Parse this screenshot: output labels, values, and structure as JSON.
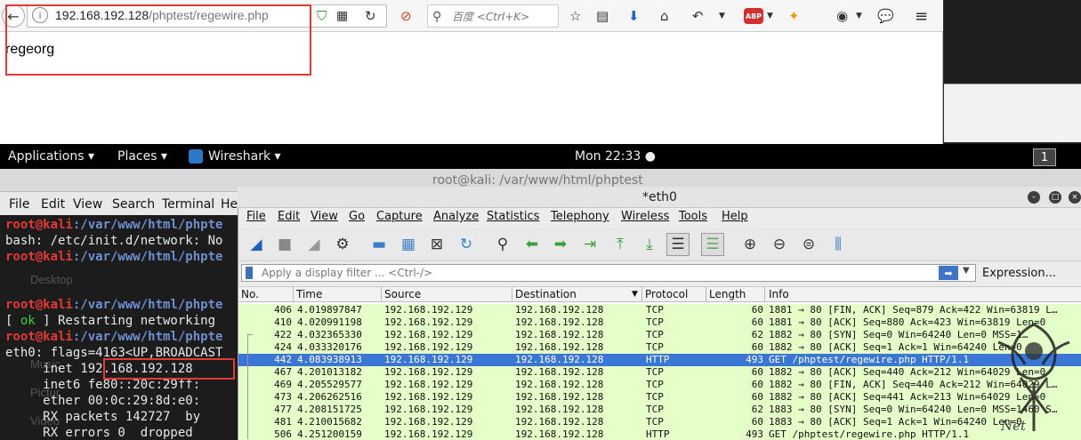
{
  "browser": {
    "url_host": "192.168.192.128",
    "url_path": "/phptest/regewire.php",
    "search_placeholder": "百度 <Ctrl+K>",
    "page_text": "regeorg",
    "adblock_badge": "ABP"
  },
  "topbar": {
    "applications": "Applications ▾",
    "places": "Places ▾",
    "wireshark": "Wireshark ▾",
    "clock": "Mon 22:33 ●",
    "workspace": "1"
  },
  "terminal": {
    "title": "root@kali: /var/www/html/phptest",
    "menu": [
      "File",
      "Edit",
      "View",
      "Search",
      "Terminal",
      "He"
    ],
    "prompt_user": "root@kali",
    "prompt_path": ":/var/www/html/phpte",
    "line_bash": "bash: /etc/init.d/network: No",
    "line_restart_open": "[ ",
    "line_restart_ok": "ok",
    "line_restart_rest": " ] Restarting networking",
    "line_eth0": "eth0: flags=4163<UP,BROADCAST",
    "inet_label": "     inet ",
    "inet_value": "192.168.192.128",
    "line_inet6": "     inet6 fe80::20c:29ff:",
    "line_ether": "     ether 00:0c:29:8d:e0:",
    "line_rxp": "     RX packets 142727  by",
    "line_rxe": "     RX errors 0  dropped",
    "ghost_desktop": "Desktop",
    "ghost_music": "Music",
    "ghost_pictures": "Pictur",
    "ghost_videos": "Video"
  },
  "wireshark": {
    "title": "*eth0",
    "menu": [
      "File",
      "Edit",
      "View",
      "Go",
      "Capture",
      "Analyze",
      "Statistics",
      "Telephony",
      "Wireless",
      "Tools",
      "Help"
    ],
    "filter_placeholder": "Apply a display filter ... <Ctrl-/>",
    "expression_label": "Expression...",
    "columns": [
      "No.",
      "Time",
      "Source",
      "Destination",
      "Protocol",
      "Length",
      "Info"
    ],
    "packets": [
      {
        "no": "406",
        "time": "4.019897847",
        "src": "192.168.192.129",
        "dst": "192.168.192.128",
        "proto": "TCP",
        "len": "60",
        "info": "1881 → 80 [FIN, ACK] Seq=879 Ack=422 Win=63819 L…"
      },
      {
        "no": "410",
        "time": "4.020991198",
        "src": "192.168.192.129",
        "dst": "192.168.192.128",
        "proto": "TCP",
        "len": "60",
        "info": "1881 → 80 [ACK] Seq=880 Ack=423 Win=63819 Len=0"
      },
      {
        "no": "422",
        "time": "4.032365330",
        "src": "192.168.192.129",
        "dst": "192.168.192.128",
        "proto": "TCP",
        "len": "62",
        "info": "1882 → 80 [SYN] Seq=0 Win=64240 Len=0 MSS=1…"
      },
      {
        "no": "424",
        "time": "4.033320176",
        "src": "192.168.192.129",
        "dst": "192.168.192.128",
        "proto": "TCP",
        "len": "60",
        "info": "1882 → 80 [ACK] Seq=1 Ack=1 Win=64240 Len=0"
      },
      {
        "no": "442",
        "time": "4.083938913",
        "src": "192.168.192.129",
        "dst": "192.168.192.128",
        "proto": "HTTP",
        "len": "493",
        "info": "GET /phptest/regewire.php HTTP/1.1"
      },
      {
        "no": "467",
        "time": "4.201013182",
        "src": "192.168.192.129",
        "dst": "192.168.192.128",
        "proto": "TCP",
        "len": "60",
        "info": "1882 → 80 [ACK] Seq=440 Ack=212 Win=64029 Len=0"
      },
      {
        "no": "469",
        "time": "4.205529577",
        "src": "192.168.192.129",
        "dst": "192.168.192.128",
        "proto": "TCP",
        "len": "60",
        "info": "1882 → 80 [FIN, ACK] Seq=440 Ack=212 Win=64029 L…"
      },
      {
        "no": "473",
        "time": "4.206262516",
        "src": "192.168.192.129",
        "dst": "192.168.192.128",
        "proto": "TCP",
        "len": "60",
        "info": "1882 → 80 [ACK] Seq=441 Ack=213 Win=64029 Len=0"
      },
      {
        "no": "477",
        "time": "4.208151725",
        "src": "192.168.192.129",
        "dst": "192.168.192.128",
        "proto": "TCP",
        "len": "62",
        "info": "1883 → 80 [SYN] Seq=0 Win=64240 Len=0 MSS=1460 S…"
      },
      {
        "no": "481",
        "time": "4.210015682",
        "src": "192.168.192.129",
        "dst": "192.168.192.128",
        "proto": "TCP",
        "len": "60",
        "info": "1883 → 80 [ACK] Seq=1 Ack=1 Win=64240 Len=0"
      },
      {
        "no": "506",
        "time": "4.251200159",
        "src": "192.168.192.129",
        "dst": "192.168.192.128",
        "proto": "HTTP",
        "len": "493",
        "info": "GET /phptest/regewire.php HTTP/1.1"
      }
    ],
    "selected_no": "442"
  },
  "watermark": {
    "text": "Net"
  },
  "colors": {
    "highlight_red": "#e53935",
    "tcp_row": "#e4ffc7",
    "selected_row": "#3a77d5"
  }
}
